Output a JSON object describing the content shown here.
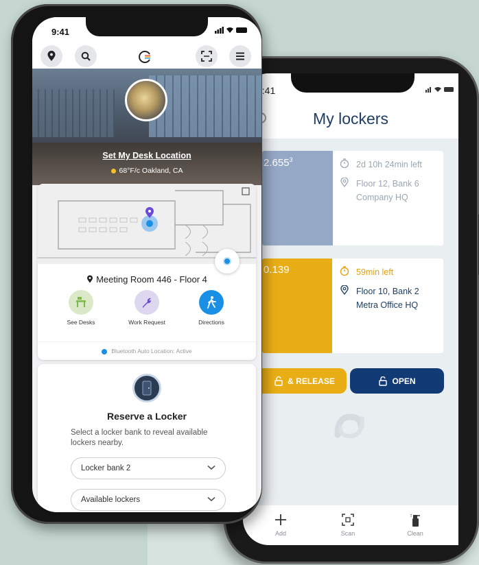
{
  "back_phone": {
    "status_time": "9:41",
    "title": "My lockers",
    "lockers": [
      {
        "number": "2.655",
        "number_sup": "3",
        "time_left": "2d 10h 24min left",
        "location": "Floor 12, Bank 6",
        "building": "Company HQ",
        "color": "#95a8c6"
      },
      {
        "number": "0.139",
        "number_sup": "",
        "time_left": "59min left",
        "location": "Floor 10, Bank 2",
        "building": "Metra Office HQ",
        "color": "#e9ae16"
      }
    ],
    "release_button": "& RELEASE",
    "open_button": "OPEN",
    "tabs": [
      {
        "label": "Add",
        "icon": "plus-icon"
      },
      {
        "label": "Scan",
        "icon": "scan-icon"
      },
      {
        "label": "Clean",
        "icon": "spray-bottle-icon"
      }
    ]
  },
  "front_phone": {
    "status_time": "9:41",
    "toolbar": [
      "location-pin-icon",
      "search-icon",
      "logo-icon",
      "scan-frame-icon",
      "menu-icon"
    ],
    "hero": {
      "desk_link": "Set My Desk Location",
      "weather": "68°F/c Oakland, CA"
    },
    "map": {
      "room_label": "Meeting Room 446 - Floor 4"
    },
    "actions": [
      {
        "label": "See Desks",
        "icon": "desk-icon",
        "color": "#dbe9c9"
      },
      {
        "label": "Work Request",
        "icon": "wrench-icon",
        "color": "#ddd7ef"
      },
      {
        "label": "Directions",
        "icon": "walk-icon",
        "color": "#1a8fe6"
      }
    ],
    "bluetooth_status": "Bluetooth Auto Location: Active",
    "locker_card": {
      "title": "Reserve a Locker",
      "description": "Select a locker bank to reveal available lockers nearby.",
      "dropdowns": [
        "Locker bank 2",
        "Available lockers"
      ]
    }
  },
  "colors": {
    "background": "#c5d7d0",
    "navy": "#123a75",
    "amber": "#e9ae16",
    "blue_accent": "#1a8fe6"
  }
}
